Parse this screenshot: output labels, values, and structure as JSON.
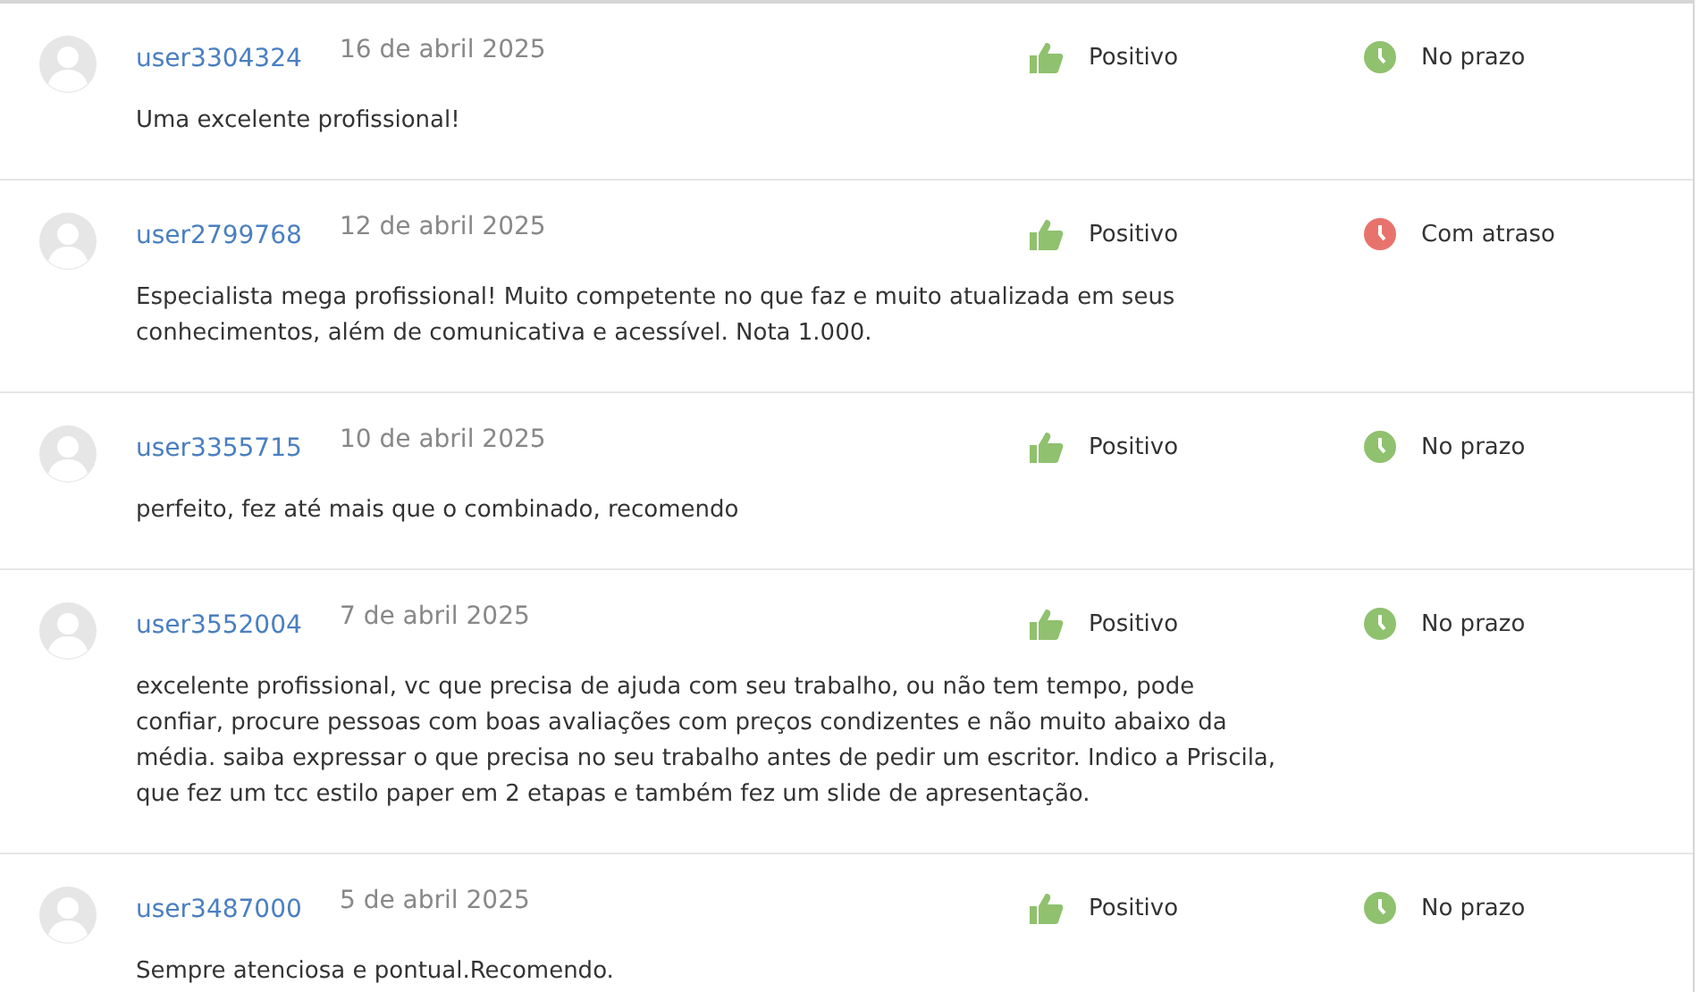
{
  "reviews": [
    {
      "user": "user3304324",
      "date": "16 de abril 2025",
      "rating": {
        "kind": "positive",
        "label": "Positivo"
      },
      "deadline": {
        "kind": "on_time",
        "label": "No prazo"
      },
      "text": "Uma excelente profissional!"
    },
    {
      "user": "user2799768",
      "date": "12 de abril 2025",
      "rating": {
        "kind": "positive",
        "label": "Positivo"
      },
      "deadline": {
        "kind": "late",
        "label": "Com atraso"
      },
      "text": "Especialista mega profissional! Muito competente no que faz e muito atualizada em seus conhecimentos, além de comunicativa e acessível. Nota 1.000."
    },
    {
      "user": "user3355715",
      "date": "10 de abril 2025",
      "rating": {
        "kind": "positive",
        "label": "Positivo"
      },
      "deadline": {
        "kind": "on_time",
        "label": "No prazo"
      },
      "text": "perfeito, fez até mais que o combinado, recomendo"
    },
    {
      "user": "user3552004",
      "date": "7 de abril 2025",
      "rating": {
        "kind": "positive",
        "label": "Positivo"
      },
      "deadline": {
        "kind": "on_time",
        "label": "No prazo"
      },
      "text": "excelente profissional, vc que precisa de ajuda com seu trabalho, ou não tem tempo, pode confiar, procure pessoas com boas avaliações com preços condizentes e não muito abaixo da média. saiba expressar o que precisa no seu trabalho antes de pedir um escritor. Indico a Priscila, que fez um tcc estilo paper em 2 etapas e também fez um slide de apresentação."
    },
    {
      "user": "user3487000",
      "date": "5 de abril 2025",
      "rating": {
        "kind": "positive",
        "label": "Positivo"
      },
      "deadline": {
        "kind": "on_time",
        "label": "No prazo"
      },
      "text": "Sempre atenciosa e pontual.Recomendo."
    }
  ]
}
